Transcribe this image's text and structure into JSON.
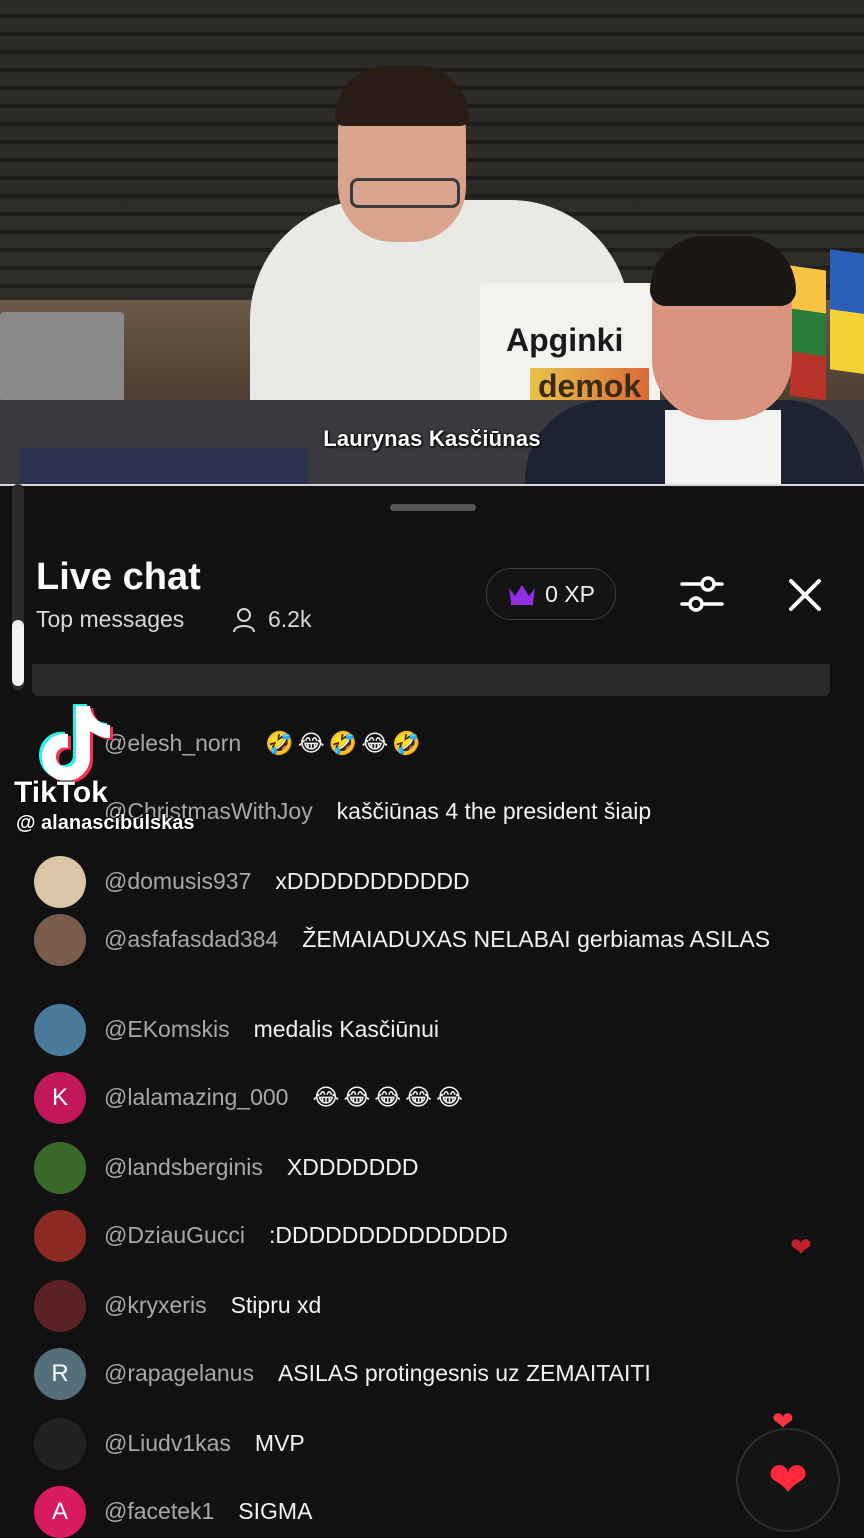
{
  "video": {
    "caption": "Laurynas Kasčiūnas",
    "sign_line1": "Apginki",
    "sign_line2": "demok"
  },
  "chat": {
    "title": "Live chat",
    "subtitle": "Top messages",
    "viewer_count": "6.2k",
    "xp_label": "0 XP",
    "icons": {
      "viewers": "person-icon",
      "xp": "crown-icon",
      "filter": "sliders-icon",
      "close": "close-icon"
    }
  },
  "watermark": {
    "brand": "TikTok",
    "handle": "@ alanascibulskas"
  },
  "messages": [
    {
      "user": "@elesh_norn",
      "text": "🤣😂🤣😂🤣",
      "avatar_letter": "",
      "avatar_color": "#8a6d4a"
    },
    {
      "user": "@ChristmasWithJoy",
      "text": "kaščiūnas 4 the president šiaip",
      "avatar_letter": "",
      "avatar_color": "#2a7a8a"
    },
    {
      "user": "@domusis937",
      "text": "xDDDDDDDDDDD",
      "avatar_letter": "",
      "avatar_color": "#d9c7a8"
    },
    {
      "user": "@asfafasdad384",
      "text": "ŽEMAIADUXAS NELABAI gerbiamas ASILAS",
      "avatar_letter": "",
      "avatar_color": "#7a5c4c"
    },
    {
      "user": "@EKomskis",
      "text": "medalis Kasčiūnui",
      "avatar_letter": "",
      "avatar_color": "#4a7a9a"
    },
    {
      "user": "@lalamazing_000",
      "text": "😂😂😂😂😂",
      "avatar_letter": "K",
      "avatar_color": "#c2185b"
    },
    {
      "user": "@landsberginis",
      "text": "XDDDDDDD",
      "avatar_letter": "",
      "avatar_color": "#3a6a2a"
    },
    {
      "user": "@DziauGucci",
      "text": ":DDDDDDDDDDDDDD",
      "avatar_letter": "",
      "avatar_color": "#8a2a22"
    },
    {
      "user": "@kryxeris",
      "text": "Stipru xd",
      "avatar_letter": "",
      "avatar_color": "#5a2222"
    },
    {
      "user": "@rapagelanus",
      "text": "ASILAS protingesnis uz ZEMAITAITI",
      "avatar_letter": "R",
      "avatar_color": "#546e7a"
    },
    {
      "user": "@Liudv1kas",
      "text": "MVP",
      "avatar_letter": "",
      "avatar_color": "#222222"
    },
    {
      "user": "@facetek1",
      "text": "SIGMA",
      "avatar_letter": "A",
      "avatar_color": "#d81b60"
    }
  ],
  "reactions": {
    "like_icon": "heart-icon"
  }
}
